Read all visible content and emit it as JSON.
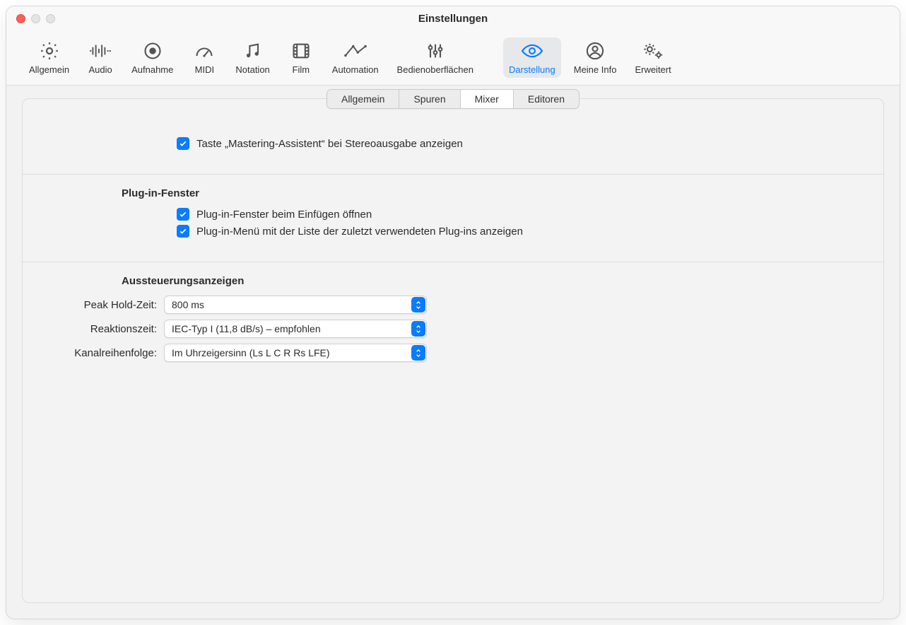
{
  "window": {
    "title": "Einstellungen"
  },
  "toolbar": {
    "items": [
      {
        "id": "general",
        "label": "Allgemein"
      },
      {
        "id": "audio",
        "label": "Audio"
      },
      {
        "id": "recording",
        "label": "Aufnahme"
      },
      {
        "id": "midi",
        "label": "MIDI"
      },
      {
        "id": "notation",
        "label": "Notation"
      },
      {
        "id": "film",
        "label": "Film"
      },
      {
        "id": "automation",
        "label": "Automation"
      },
      {
        "id": "surfaces",
        "label": "Bedienoberflächen"
      },
      {
        "id": "display",
        "label": "Darstellung",
        "selected": true
      },
      {
        "id": "myinfo",
        "label": "Meine Info"
      },
      {
        "id": "advanced",
        "label": "Erweitert"
      }
    ]
  },
  "tabs": {
    "items": [
      {
        "label": "Allgemein"
      },
      {
        "label": "Spuren"
      },
      {
        "label": "Mixer",
        "active": true
      },
      {
        "label": "Editoren"
      }
    ]
  },
  "checkboxes": {
    "mastering_assistant": {
      "label": "Taste „Mastering-Assistent“ bei Stereoausgabe anzeigen",
      "checked": true
    },
    "plugin_open": {
      "label": "Plug-in-Fenster beim Einfügen öffnen",
      "checked": true
    },
    "plugin_recent": {
      "label": "Plug-in-Menü mit der Liste der zuletzt verwendeten Plug-ins anzeigen",
      "checked": true
    }
  },
  "sections": {
    "plugin_window_heading": "Plug-in-Fenster",
    "level_meters_heading": "Aussteuerungsanzeigen"
  },
  "selects": {
    "peak_hold": {
      "label": "Peak Hold-Zeit:",
      "value": "800 ms"
    },
    "response": {
      "label": "Reaktionszeit:",
      "value": "IEC-Typ I (11,8 dB/s) – empfohlen"
    },
    "channel_order": {
      "label": "Kanalreihenfolge:",
      "value": "Im Uhrzeigersinn (Ls L C R Rs LFE)"
    }
  }
}
